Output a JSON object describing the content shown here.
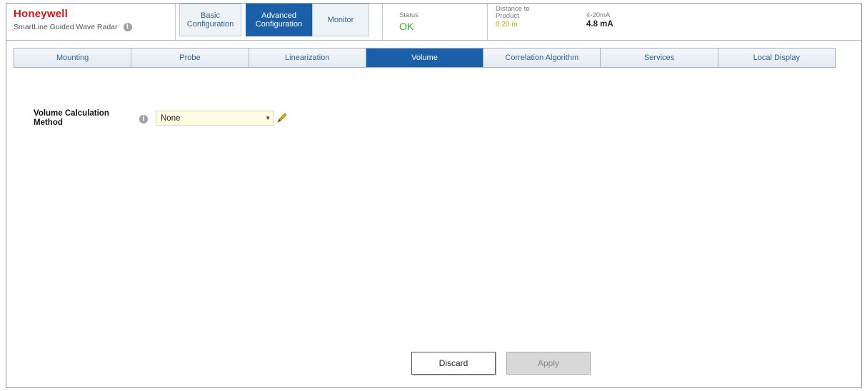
{
  "brand": {
    "name": "Honeywell",
    "product": "SmartLine Guided Wave Radar"
  },
  "main_tabs": [
    {
      "label": "Basic\nConfiguration",
      "active": false
    },
    {
      "label": "Advanced\nConfiguration",
      "active": true
    },
    {
      "label": "Monitor",
      "active": false
    }
  ],
  "status": {
    "status_label": "Status",
    "status_value": "OK",
    "distance_label": "Distance to\nProduct",
    "distance_value": "0.20 m",
    "current_label": "4-20mA",
    "current_value": "4.8 mA"
  },
  "sub_tabs": [
    {
      "label": "Mounting",
      "active": false
    },
    {
      "label": "Probe",
      "active": false
    },
    {
      "label": "Linearization",
      "active": false
    },
    {
      "label": "Volume",
      "active": true
    },
    {
      "label": "Correlation Algorithm",
      "active": false
    },
    {
      "label": "Services",
      "active": false
    },
    {
      "label": "Local Display",
      "active": false
    }
  ],
  "form": {
    "volume_method_label": "Volume Calculation\nMethod",
    "volume_method_value": "None"
  },
  "buttons": {
    "discard": "Discard",
    "apply": "Apply"
  },
  "colors": {
    "brand_red": "#d0161a",
    "active_tab": "#1a5fa8",
    "status_ok": "#3aa53a",
    "distance_value": "#c8a800",
    "select_bg": "#fffde3"
  }
}
